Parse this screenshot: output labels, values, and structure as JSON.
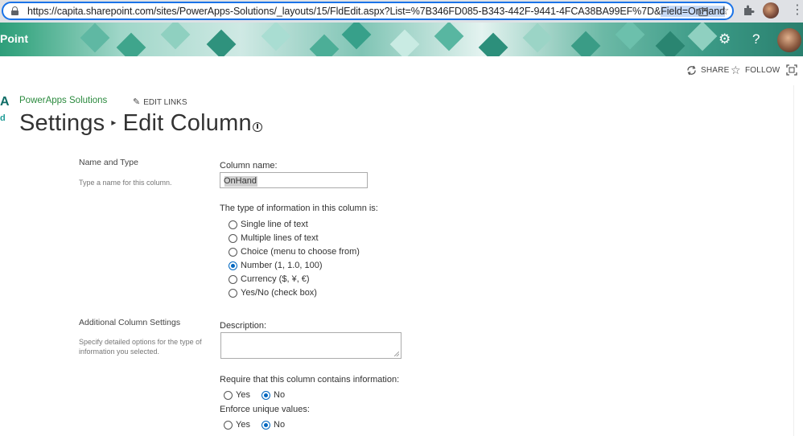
{
  "browser": {
    "url_prefix": "https://capita.sharepoint.com/sites/PowerApps-Solutions/_layouts/15/FldEdit.aspx?List=%7B346FD085-B343-442F-9441-4FCA38BA99EF%7D&",
    "url_selected": "Field=OnHand"
  },
  "suitebar": {
    "brand": "Point",
    "settings_glyph": "⚙",
    "help_glyph": "?"
  },
  "actions": {
    "share": "SHARE",
    "follow": "FOLLOW"
  },
  "left": {
    "logo_char": "A",
    "logo_sub": "d"
  },
  "site": {
    "name": "PowerApps Solutions",
    "edit_links": "EDIT LINKS"
  },
  "page": {
    "title_part1": "Settings",
    "title_sep": "▸",
    "title_part2": "Edit Column"
  },
  "name_type": {
    "title": "Name and Type",
    "desc": "Type a name for this column.",
    "column_name_label": "Column name:",
    "column_name_value": "OnHand",
    "type_label": "The type of information in this column is:",
    "types": [
      {
        "label": "Single line of text",
        "checked": false
      },
      {
        "label": "Multiple lines of text",
        "checked": false
      },
      {
        "label": "Choice (menu to choose from)",
        "checked": false
      },
      {
        "label": "Number (1, 1.0, 100)",
        "checked": true
      },
      {
        "label": "Currency ($, ¥, €)",
        "checked": false
      },
      {
        "label": "Yes/No (check box)",
        "checked": false
      }
    ]
  },
  "additional": {
    "title": "Additional Column Settings",
    "desc": "Specify detailed options for the type of information you selected.",
    "description_label": "Description:",
    "description_value": "",
    "require_label": "Require that this column contains information:",
    "require_yes": "Yes",
    "require_no": "No",
    "require_value": "No",
    "unique_label": "Enforce unique values:",
    "unique_yes": "Yes",
    "unique_no": "No",
    "unique_value": "No"
  },
  "colors": {
    "accent": "#0067c0",
    "site_link": "#2b8a3e",
    "banner_teal": "#2e9e7a"
  }
}
